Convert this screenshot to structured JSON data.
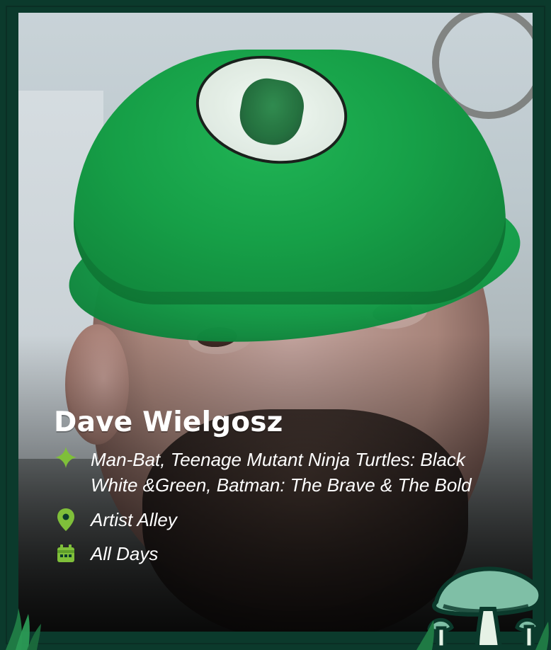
{
  "profile": {
    "name": "Dave Wielgosz",
    "description": "Man-Bat, Teenage Mutant Ninja Turtles: Black White &Green, Batman: The Brave & The Bold",
    "location": "Artist Alley",
    "days": "All Days"
  },
  "icons": {
    "description_icon": "sparkle-icon",
    "location_icon": "map-pin-icon",
    "days_icon": "calendar-icon"
  },
  "colors": {
    "border": "#0b3a2c",
    "accent_green": "#7fbf3a",
    "text": "#ffffff"
  }
}
